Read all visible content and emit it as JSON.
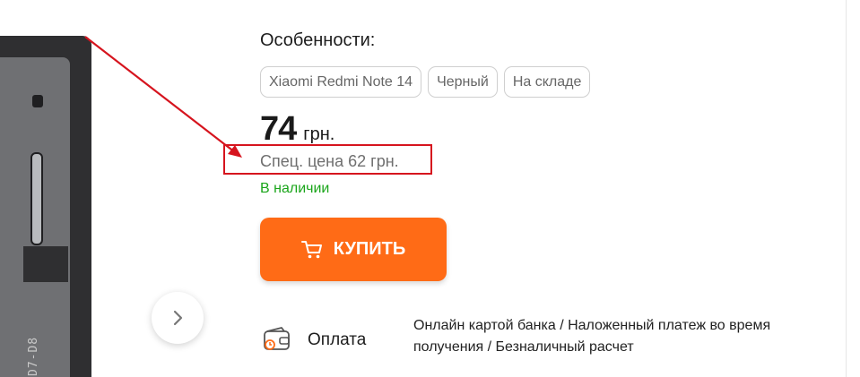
{
  "product": {
    "image_engraving": "D7-D8"
  },
  "features": {
    "title": "Особенности:",
    "tags": [
      "Xiaomi Redmi Note 14",
      "Черный",
      "На складе"
    ]
  },
  "price": {
    "value": "74",
    "currency": "грн.",
    "special": "Спец. цена 62 грн.",
    "stock": "В наличии"
  },
  "buy_button": {
    "label": "КУПИТЬ"
  },
  "payment": {
    "label": "Оплата",
    "description": "Онлайн картой банка / Наложенный платеж во время получения / Безналичный расчет"
  },
  "colors": {
    "accent": "#ff6b16",
    "in_stock": "#1aa51a",
    "annotation": "#d6141e"
  },
  "icons": {
    "cart": "cart-icon",
    "next": "chevron-right-icon",
    "payment": "wallet-icon"
  }
}
